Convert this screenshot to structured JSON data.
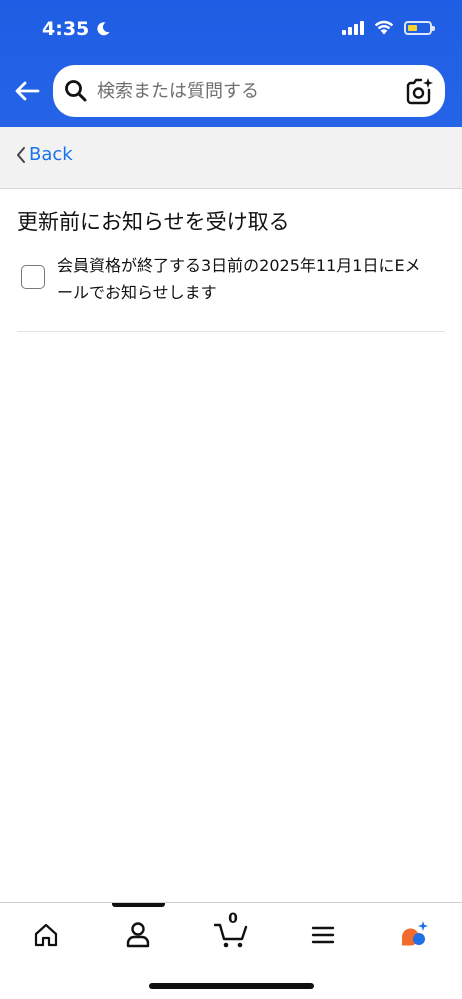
{
  "status_bar": {
    "time": "4:35",
    "icons": [
      "moon-icon",
      "cellular-signal-icon",
      "wifi-icon",
      "battery-icon"
    ],
    "battery_color": "#f6d32d"
  },
  "header": {
    "background_color": "#2563e7",
    "search": {
      "placeholder": "検索または質問する",
      "value": ""
    }
  },
  "back_bar": {
    "label": "Back",
    "link_color": "#1a73e8"
  },
  "main": {
    "title": "更新前にお知らせを受け取る",
    "checkbox": {
      "checked": false,
      "label": "会員資格が終了する3日前の2025年11月1日にEメールでお知らせします"
    }
  },
  "bottom_nav": {
    "items": [
      {
        "name": "home",
        "icon": "home-icon"
      },
      {
        "name": "account",
        "icon": "person-icon",
        "selected": true
      },
      {
        "name": "cart",
        "icon": "cart-icon"
      },
      {
        "name": "menu",
        "icon": "menu-icon"
      },
      {
        "name": "rufus",
        "icon": "ai-assistant-icon"
      }
    ],
    "cart_count": "0",
    "accent_colors": {
      "orange": "#f26b2c",
      "blue": "#1f6fe5"
    }
  }
}
